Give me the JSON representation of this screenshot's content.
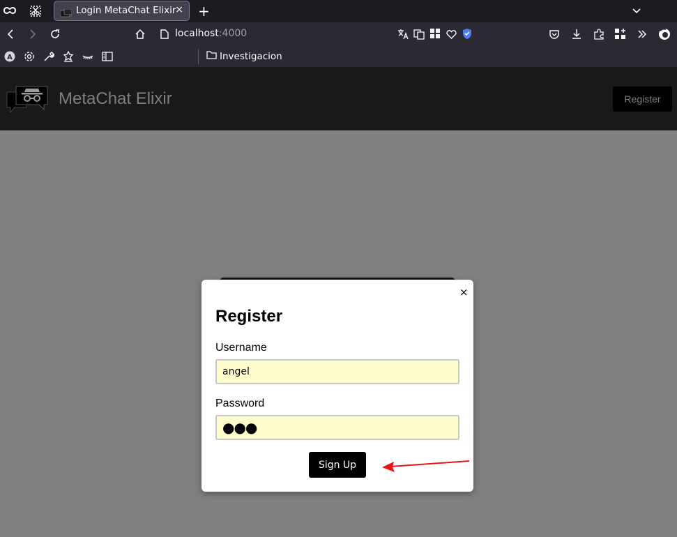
{
  "browser": {
    "tab": {
      "title": "Login MetaChat Elixir",
      "close": "×"
    },
    "new_tab": "+",
    "url": {
      "host": "localhost",
      "port": ":4000"
    },
    "bookmarks": {
      "folder": "Investigacion"
    },
    "accent_color": "#b04fd8"
  },
  "header": {
    "brand": "MetaChat Elixir",
    "register_label": "Register",
    "background": "#191919"
  },
  "modal": {
    "close": "×",
    "title": "Register",
    "username_label": "Username",
    "username_value": "angel",
    "password_label": "Password",
    "password_value": "●●●",
    "submit_label": "Sign Up",
    "field_background": "#fffdcc"
  },
  "annotation": {
    "arrow_color": "#e8141a"
  }
}
